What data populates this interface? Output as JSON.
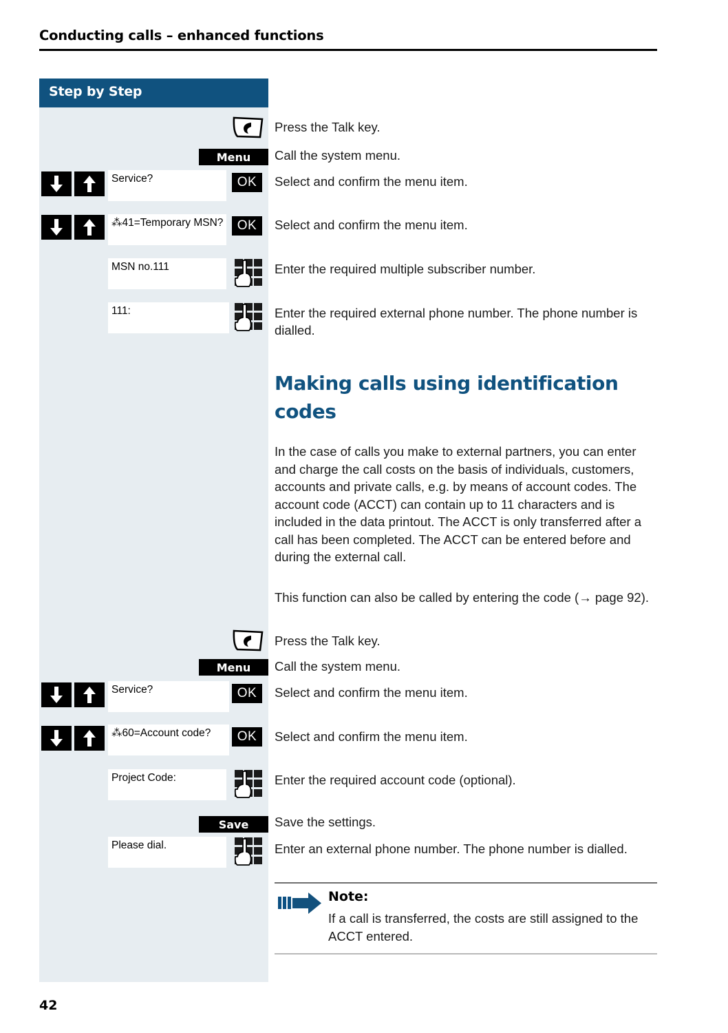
{
  "header": {
    "title": "Conducting calls – enhanced functions"
  },
  "sidebar": {
    "title": "Step by Step"
  },
  "footer": {
    "page_number": "42"
  },
  "colors": {
    "brand_blue": "#10527f",
    "sidebar_bg": "#e7edf1",
    "key_black": "#000000",
    "display_white": "#ffffff"
  },
  "icons": {
    "talk_key": "talk-key-icon",
    "keypad": "keypad-icon",
    "arrow_down": "arrow-down-icon",
    "arrow_up": "arrow-up-icon",
    "note_arrow": "note-arrow-icon"
  },
  "steps": [
    {
      "widget": "talk-key",
      "display": null,
      "key": null,
      "text": "Press the Talk key."
    },
    {
      "widget": "keycap",
      "display": null,
      "key": "Menu",
      "text": "Call the system menu."
    },
    {
      "widget": "nav-ok",
      "display": "Service?",
      "key": "OK",
      "text": "Select and confirm the menu item."
    },
    {
      "widget": "nav-ok",
      "display": "⁂41=Temporary MSN?",
      "key": "OK",
      "text": "Select and confirm the menu item."
    },
    {
      "widget": "keypad",
      "display": "MSN no.111",
      "key": null,
      "text": "Enter the required multiple subscriber number."
    },
    {
      "widget": "keypad",
      "display": "111:",
      "key": null,
      "text": "Enter the required external phone number. The phone number is dialled."
    }
  ],
  "section": {
    "heading": "Making calls using identification codes",
    "paragraph_1": "In the case of calls you make to external partners, you can enter and charge the call costs on the basis of individuals, customers, accounts and private calls, e.g.  by means of account codes. The account code (ACCT) can contain up to 11 characters and is included in the data printout. The ACCT is only transferred after a call has been completed. The ACCT can be entered before and during the external call.",
    "paragraph_2": "This function can also be called by entering the code (→ page 92)."
  },
  "steps2": [
    {
      "widget": "talk-key",
      "display": null,
      "key": null,
      "text": "Press the Talk key."
    },
    {
      "widget": "keycap",
      "display": null,
      "key": "Menu",
      "text": "Call the system menu."
    },
    {
      "widget": "nav-ok",
      "display": "Service?",
      "key": "OK",
      "text": "Select and confirm the menu item."
    },
    {
      "widget": "nav-ok",
      "display": "⁂60=Account code?",
      "key": "OK",
      "text": "Select and confirm the menu item."
    },
    {
      "widget": "keypad",
      "display": "Project Code:",
      "key": null,
      "text": "Enter the required account code (optional)."
    },
    {
      "widget": "keycap",
      "display": null,
      "key": "Save",
      "text": "Save the settings."
    },
    {
      "widget": "keypad",
      "display": "Please dial.",
      "key": null,
      "text": "Enter an external phone number. The phone number is dialled."
    }
  ],
  "note": {
    "label": "Note:",
    "text": "If a call is transferred, the costs are still assigned to the ACCT entered."
  }
}
